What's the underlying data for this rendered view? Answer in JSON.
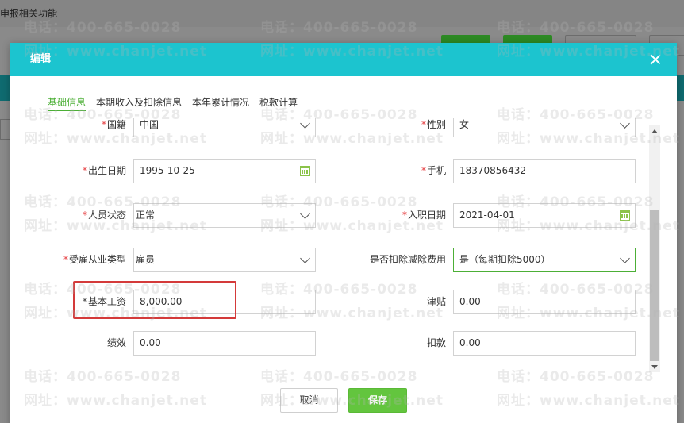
{
  "background": {
    "topbar_text": "申报相关功能"
  },
  "modal": {
    "title": "编辑",
    "tabs": [
      {
        "label": "基础信息",
        "active": true
      },
      {
        "label": "本期收入及扣除信息",
        "active": false
      },
      {
        "label": "本年累计情况",
        "active": false
      },
      {
        "label": "税款计算",
        "active": false
      }
    ],
    "fields": {
      "nationality": {
        "label": "国籍",
        "required": true,
        "value": "中国"
      },
      "gender": {
        "label": "性别",
        "required": true,
        "value": "女"
      },
      "birth_date": {
        "label": "出生日期",
        "required": true,
        "value": "1995-10-25"
      },
      "phone": {
        "label": "手机",
        "required": true,
        "value": "18370856432"
      },
      "status": {
        "label": "人员状态",
        "required": true,
        "value": "正常"
      },
      "hire_date": {
        "label": "入职日期",
        "required": true,
        "value": "2021-04-01"
      },
      "employment_type": {
        "label": "受雇从业类型",
        "required": true,
        "value": "雇员"
      },
      "deduction": {
        "label": "是否扣除减除费用",
        "required": false,
        "value": "是（每期扣除5000）"
      },
      "base_salary": {
        "label": "基本工资",
        "required": true,
        "value": "8,000.00"
      },
      "allowance": {
        "label": "津贴",
        "required": false,
        "value": "0.00"
      },
      "performance": {
        "label": "绩效",
        "required": false,
        "value": "0.00"
      },
      "deduct_amount": {
        "label": "扣款",
        "required": false,
        "value": "0.00"
      }
    },
    "buttons": {
      "cancel": "取消",
      "save": "保存"
    }
  },
  "watermarks": {
    "phone": "电话：400-665-0028",
    "site": "网址：www.chanjet.net"
  },
  "colors": {
    "header": "#1cc4cf",
    "accent": "#4caf36",
    "save_button": "#63c53e",
    "highlight": "#d43a3a",
    "required": "#e5383b"
  }
}
